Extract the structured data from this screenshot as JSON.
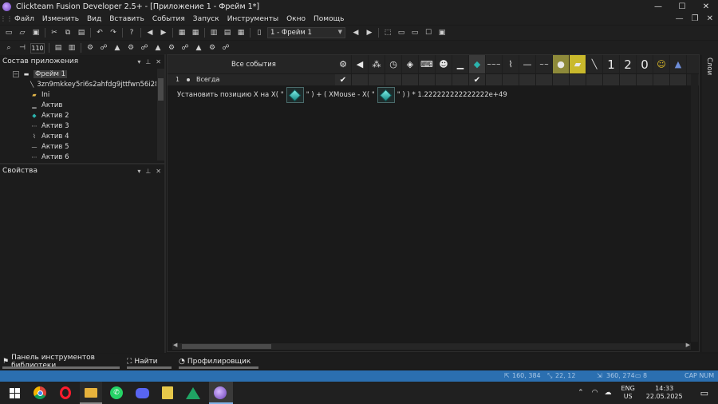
{
  "window": {
    "title": "Clickteam Fusion Developer 2.5+ - [Приложение 1 - Фрейм 1*]",
    "controls": [
      "—",
      "☐",
      "✕"
    ]
  },
  "menu": [
    "Файл",
    "Изменить",
    "Вид",
    "Вставить",
    "События",
    "Запуск",
    "Инструменты",
    "Окно",
    "Помощь"
  ],
  "menu_right": [
    "—",
    "❐",
    "✕"
  ],
  "toolbar": {
    "frame_select": "1 - Фрейм 1",
    "zoom_value": "110"
  },
  "workspace_panel": {
    "title": "Состав приложения",
    "tree": [
      {
        "label": "Фрейм 1",
        "icon": "frame-icon",
        "selected": true
      },
      {
        "label": "3zn9mkkey5ri6s2ahfdg9jttfwn56i28",
        "icon": "line-object-icon"
      },
      {
        "label": "Ini",
        "icon": "folder-icon"
      },
      {
        "label": "Актив",
        "icon": "active-icon"
      },
      {
        "label": "Актив 2",
        "icon": "diamond-icon"
      },
      {
        "label": "Актив 3",
        "icon": "dots-icon"
      },
      {
        "label": "Актив 4",
        "icon": "squiggle-icon"
      },
      {
        "label": "Актив 5",
        "icon": "line-icon"
      },
      {
        "label": "Актив 6",
        "icon": "dots-icon"
      }
    ]
  },
  "properties_panel": {
    "title": "Свойства"
  },
  "event_editor": {
    "header_label": "Все события",
    "event": {
      "number": "1",
      "condition": "Всегда"
    },
    "action_parts": {
      "p1": "Установить позицию X на X( \"",
      "p2": "\" ) + ( XMouse - X( \"",
      "p3": "\" ) ) * 1.222222222222222e+49"
    },
    "object_icons": [
      "system-icon",
      "sound-icon",
      "storyboard-icon",
      "timer-icon",
      "create-icon",
      "keyboard-icon",
      "player-icon",
      "active-icon",
      "diamond-icon",
      "text-icon",
      "squiggle-icon",
      "line-icon",
      "text-icon",
      "lamp-icon",
      "yellow-icon",
      "stick-icon",
      "digit-one-icon",
      "digit-two-icon",
      "digit-zero-icon",
      "emoji-icon",
      "triangle-icon"
    ],
    "checks": {
      "system_col": "✔",
      "diamond_col": "✔"
    }
  },
  "digits": [
    "1",
    "2",
    "0"
  ],
  "right_tab": "Слои",
  "bottom_tabs": [
    {
      "label": "Панель инструментов библиотеки",
      "icon": "library-icon"
    },
    {
      "label": "Найти",
      "icon": "binoculars-icon"
    },
    {
      "label": "Профилировщик",
      "icon": "profiler-icon"
    }
  ],
  "statusbar": {
    "mouse_pos": "160, 384",
    "size": "22, 12",
    "frame_pos": "360, 274",
    "count": "8",
    "keys": "CAP  NUM"
  },
  "taskbar": {
    "apps": [
      "start-icon",
      "chrome-icon",
      "opera-icon",
      "files-icon",
      "whatsapp-icon",
      "discord-icon",
      "notes-icon",
      "drive-icon",
      "fusion-icon"
    ],
    "lang": "ENG",
    "region": "US",
    "time": "14:33",
    "date": "22.05.2025"
  },
  "colors": {
    "statusbar_bg": "#2b6fb0",
    "teal_diamond": "#2bb3ad",
    "editor_bg": "#1a1a1a"
  }
}
